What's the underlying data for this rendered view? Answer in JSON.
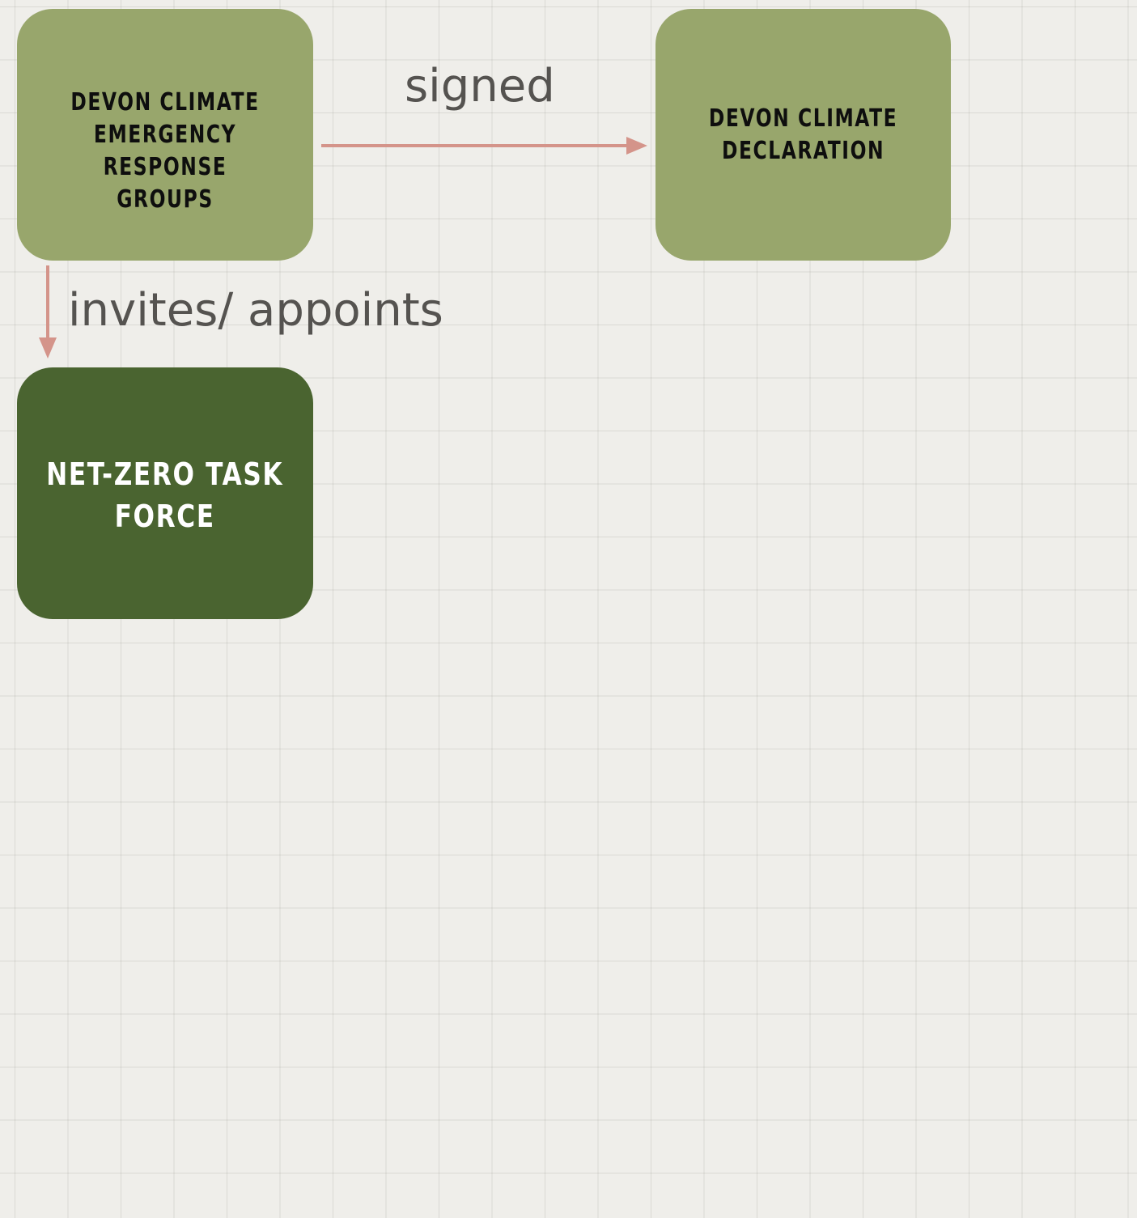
{
  "diagram": {
    "colors": {
      "background": "#efeeea",
      "grid_line": "#8c8c82",
      "node_light": "#98a66c",
      "node_dark": "#4a6430",
      "text_on_light": "#0e0e0e",
      "text_on_dark": "#ffffff",
      "arrow": "#d4948a",
      "edge_label": "#555350"
    },
    "nodes": {
      "response_groups": {
        "label": "DEVON CLIMATE\nEMERGENCY RESPONSE\nGROUPS",
        "style": "light"
      },
      "declaration": {
        "label": "DEVON CLIMATE\nDECLARATION",
        "style": "light"
      },
      "task_force": {
        "label": "NET-ZERO TASK\nFORCE",
        "style": "dark"
      }
    },
    "edges": [
      {
        "from": "response_groups",
        "to": "declaration",
        "label": "signed"
      },
      {
        "from": "response_groups",
        "to": "task_force",
        "label": "invites/ appoints"
      }
    ]
  }
}
